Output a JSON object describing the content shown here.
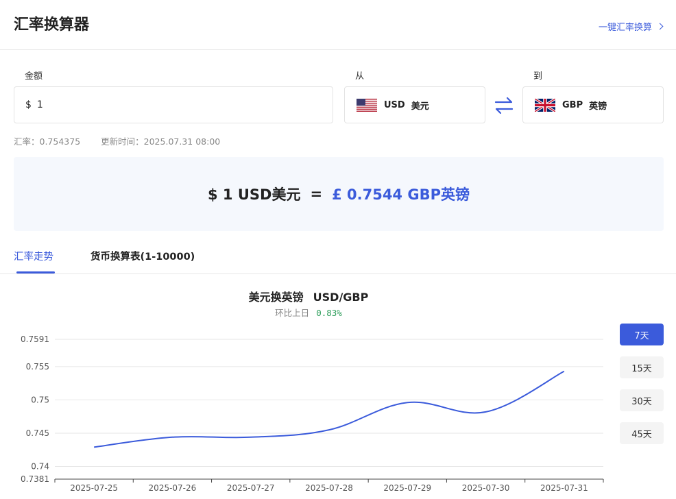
{
  "header": {
    "title": "汇率换算器",
    "link_label": "一键汇率换算"
  },
  "form": {
    "amount_label": "金额",
    "amount_symbol": "$",
    "amount_value": "1",
    "from_label": "从",
    "from_code": "USD",
    "from_name": "美元",
    "to_label": "到",
    "to_code": "GBP",
    "to_name": "英镑"
  },
  "rate_info": {
    "rate_label": "汇率：0.754375",
    "updated_label": "更新时间：2025.07.31 08:00"
  },
  "result": {
    "lhs": "$ 1 USD美元",
    "eq": "=",
    "rhs": "£ 0.7544 GBP英镑"
  },
  "tabs": [
    {
      "label": "汇率走势",
      "active": true
    },
    {
      "label": "货币换算表(1-10000)",
      "active": false
    }
  ],
  "chart_header": {
    "title": "美元换英镑",
    "pair": "USD/GBP",
    "change_label": "环比上日",
    "change_value": "0.83%"
  },
  "range_buttons": [
    {
      "label": "7天",
      "active": true
    },
    {
      "label": "15天",
      "active": false
    },
    {
      "label": "30天",
      "active": false
    },
    {
      "label": "45天",
      "active": false
    }
  ],
  "colors": {
    "accent": "#3b5bdb",
    "positive": "#2e9e5b",
    "result_bg": "#f5f8fd"
  },
  "chart_data": {
    "type": "line",
    "title": "",
    "xlabel": "",
    "ylabel": "",
    "x": [
      "2025-07-25",
      "2025-07-26",
      "2025-07-27",
      "2025-07-28",
      "2025-07-29",
      "2025-07-30",
      "2025-07-31"
    ],
    "series": [
      {
        "values": [
          0.7429,
          0.7444,
          0.7444,
          0.7455,
          0.7496,
          0.7482,
          0.7543
        ]
      }
    ],
    "yticks": [
      0.7381,
      0.74,
      0.745,
      0.75,
      0.755,
      0.7591
    ],
    "ytick_labels": [
      "0.7381",
      "0.74",
      "0.745",
      "0.75",
      "0.755",
      "0.7591"
    ],
    "ylim": [
      0.7381,
      0.7591
    ],
    "grid": true,
    "legend": "none"
  }
}
